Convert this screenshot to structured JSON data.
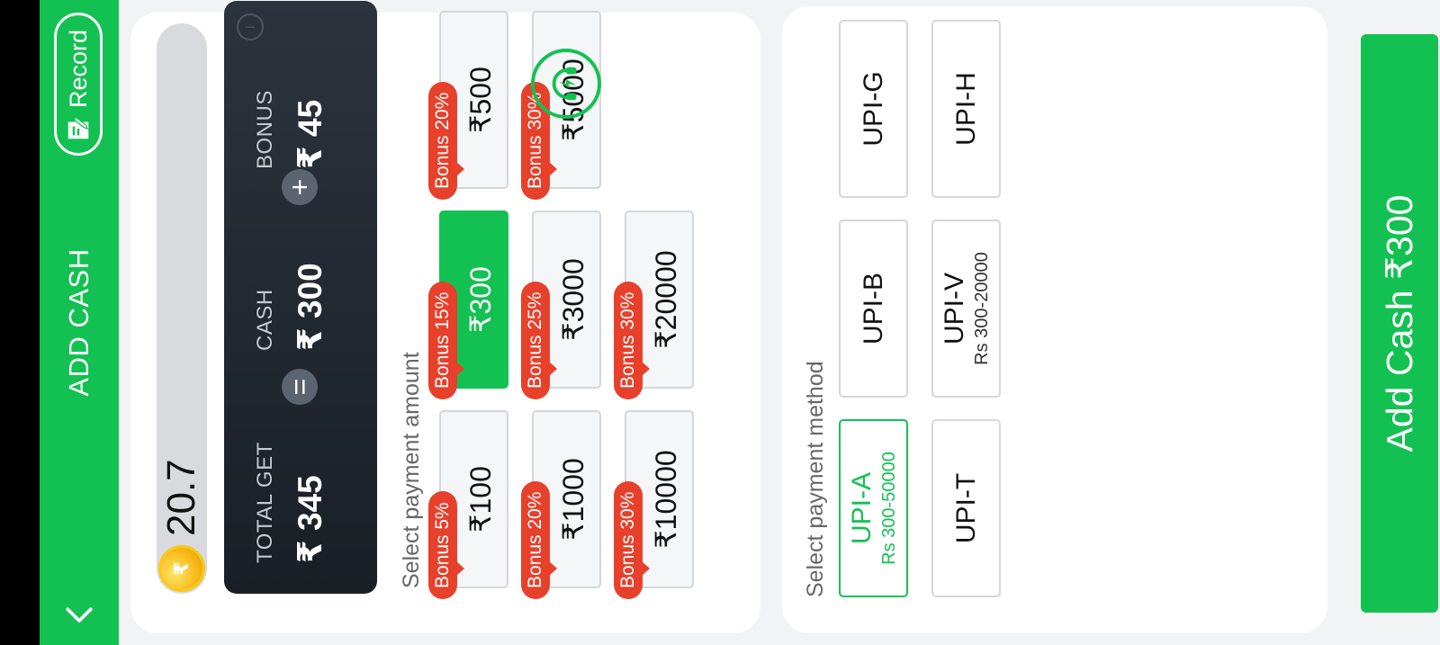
{
  "header": {
    "title": "ADD CASH",
    "record_label": "Record"
  },
  "balance": {
    "value": "20.7"
  },
  "summary": {
    "total_label": "TOTAL GET",
    "total_value": "₹ 345",
    "cash_label": "CASH",
    "cash_value": "₹ 300",
    "bonus_label": "BONUS",
    "bonus_value": "₹ 45"
  },
  "amount_section": {
    "label": "Select payment amount",
    "options": [
      {
        "amount": "₹100",
        "bonus": "Bonus 5%"
      },
      {
        "amount": "₹300",
        "bonus": "Bonus 15%"
      },
      {
        "amount": "₹500",
        "bonus": "Bonus 20%"
      },
      {
        "amount": "₹1000",
        "bonus": "Bonus 20%"
      },
      {
        "amount": "₹3000",
        "bonus": "Bonus 25%"
      },
      {
        "amount": "₹5000",
        "bonus": "Bonus 30%"
      },
      {
        "amount": "₹10000",
        "bonus": "Bonus 30%"
      },
      {
        "amount": "₹20000",
        "bonus": "Bonus 30%"
      }
    ],
    "selected_index": 1
  },
  "method_section": {
    "label": "Select payment method",
    "methods": [
      {
        "name": "UPI-A",
        "range": "Rs 300-50000"
      },
      {
        "name": "UPI-B",
        "range": ""
      },
      {
        "name": "UPI-G",
        "range": ""
      },
      {
        "name": "UPI-T",
        "range": ""
      },
      {
        "name": "UPI-V",
        "range": "Rs 300-20000"
      },
      {
        "name": "UPI-H",
        "range": ""
      }
    ],
    "selected_index": 0
  },
  "cta": {
    "label": "Add Cash ₹300"
  },
  "colors": {
    "brand_green": "#13c152",
    "bonus_red": "#e7402b",
    "card_dark": "#1a1f26"
  },
  "icons": {
    "back": "chevron-left-icon",
    "record": "record-icon",
    "coin": "coin-icon",
    "support": "support-headset-icon"
  }
}
